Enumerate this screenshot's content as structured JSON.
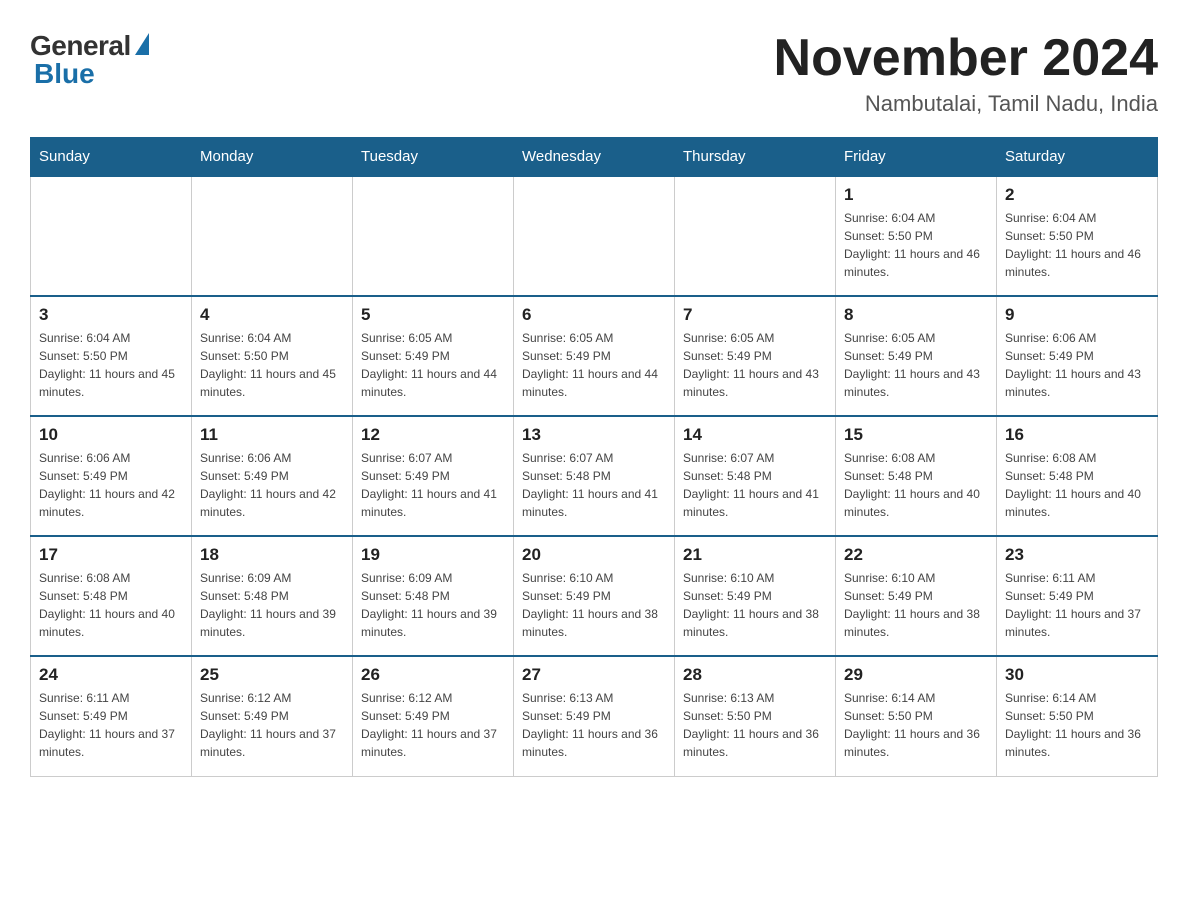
{
  "logo": {
    "general": "General",
    "blue": "Blue"
  },
  "title": "November 2024",
  "location": "Nambutalai, Tamil Nadu, India",
  "days_of_week": [
    "Sunday",
    "Monday",
    "Tuesday",
    "Wednesday",
    "Thursday",
    "Friday",
    "Saturday"
  ],
  "weeks": [
    [
      {
        "day": "",
        "info": ""
      },
      {
        "day": "",
        "info": ""
      },
      {
        "day": "",
        "info": ""
      },
      {
        "day": "",
        "info": ""
      },
      {
        "day": "",
        "info": ""
      },
      {
        "day": "1",
        "info": "Sunrise: 6:04 AM\nSunset: 5:50 PM\nDaylight: 11 hours and 46 minutes."
      },
      {
        "day": "2",
        "info": "Sunrise: 6:04 AM\nSunset: 5:50 PM\nDaylight: 11 hours and 46 minutes."
      }
    ],
    [
      {
        "day": "3",
        "info": "Sunrise: 6:04 AM\nSunset: 5:50 PM\nDaylight: 11 hours and 45 minutes."
      },
      {
        "day": "4",
        "info": "Sunrise: 6:04 AM\nSunset: 5:50 PM\nDaylight: 11 hours and 45 minutes."
      },
      {
        "day": "5",
        "info": "Sunrise: 6:05 AM\nSunset: 5:49 PM\nDaylight: 11 hours and 44 minutes."
      },
      {
        "day": "6",
        "info": "Sunrise: 6:05 AM\nSunset: 5:49 PM\nDaylight: 11 hours and 44 minutes."
      },
      {
        "day": "7",
        "info": "Sunrise: 6:05 AM\nSunset: 5:49 PM\nDaylight: 11 hours and 43 minutes."
      },
      {
        "day": "8",
        "info": "Sunrise: 6:05 AM\nSunset: 5:49 PM\nDaylight: 11 hours and 43 minutes."
      },
      {
        "day": "9",
        "info": "Sunrise: 6:06 AM\nSunset: 5:49 PM\nDaylight: 11 hours and 43 minutes."
      }
    ],
    [
      {
        "day": "10",
        "info": "Sunrise: 6:06 AM\nSunset: 5:49 PM\nDaylight: 11 hours and 42 minutes."
      },
      {
        "day": "11",
        "info": "Sunrise: 6:06 AM\nSunset: 5:49 PM\nDaylight: 11 hours and 42 minutes."
      },
      {
        "day": "12",
        "info": "Sunrise: 6:07 AM\nSunset: 5:49 PM\nDaylight: 11 hours and 41 minutes."
      },
      {
        "day": "13",
        "info": "Sunrise: 6:07 AM\nSunset: 5:48 PM\nDaylight: 11 hours and 41 minutes."
      },
      {
        "day": "14",
        "info": "Sunrise: 6:07 AM\nSunset: 5:48 PM\nDaylight: 11 hours and 41 minutes."
      },
      {
        "day": "15",
        "info": "Sunrise: 6:08 AM\nSunset: 5:48 PM\nDaylight: 11 hours and 40 minutes."
      },
      {
        "day": "16",
        "info": "Sunrise: 6:08 AM\nSunset: 5:48 PM\nDaylight: 11 hours and 40 minutes."
      }
    ],
    [
      {
        "day": "17",
        "info": "Sunrise: 6:08 AM\nSunset: 5:48 PM\nDaylight: 11 hours and 40 minutes."
      },
      {
        "day": "18",
        "info": "Sunrise: 6:09 AM\nSunset: 5:48 PM\nDaylight: 11 hours and 39 minutes."
      },
      {
        "day": "19",
        "info": "Sunrise: 6:09 AM\nSunset: 5:48 PM\nDaylight: 11 hours and 39 minutes."
      },
      {
        "day": "20",
        "info": "Sunrise: 6:10 AM\nSunset: 5:49 PM\nDaylight: 11 hours and 38 minutes."
      },
      {
        "day": "21",
        "info": "Sunrise: 6:10 AM\nSunset: 5:49 PM\nDaylight: 11 hours and 38 minutes."
      },
      {
        "day": "22",
        "info": "Sunrise: 6:10 AM\nSunset: 5:49 PM\nDaylight: 11 hours and 38 minutes."
      },
      {
        "day": "23",
        "info": "Sunrise: 6:11 AM\nSunset: 5:49 PM\nDaylight: 11 hours and 37 minutes."
      }
    ],
    [
      {
        "day": "24",
        "info": "Sunrise: 6:11 AM\nSunset: 5:49 PM\nDaylight: 11 hours and 37 minutes."
      },
      {
        "day": "25",
        "info": "Sunrise: 6:12 AM\nSunset: 5:49 PM\nDaylight: 11 hours and 37 minutes."
      },
      {
        "day": "26",
        "info": "Sunrise: 6:12 AM\nSunset: 5:49 PM\nDaylight: 11 hours and 37 minutes."
      },
      {
        "day": "27",
        "info": "Sunrise: 6:13 AM\nSunset: 5:49 PM\nDaylight: 11 hours and 36 minutes."
      },
      {
        "day": "28",
        "info": "Sunrise: 6:13 AM\nSunset: 5:50 PM\nDaylight: 11 hours and 36 minutes."
      },
      {
        "day": "29",
        "info": "Sunrise: 6:14 AM\nSunset: 5:50 PM\nDaylight: 11 hours and 36 minutes."
      },
      {
        "day": "30",
        "info": "Sunrise: 6:14 AM\nSunset: 5:50 PM\nDaylight: 11 hours and 36 minutes."
      }
    ]
  ]
}
